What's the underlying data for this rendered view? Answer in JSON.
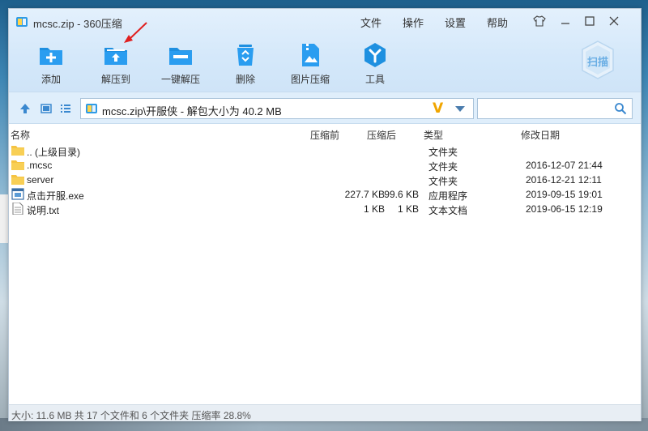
{
  "window": {
    "title": "mcsc.zip - 360压缩",
    "menu": [
      "文件",
      "操作",
      "设置",
      "帮助"
    ]
  },
  "toolbar": [
    {
      "label": "添加",
      "icon": "add-folder-icon"
    },
    {
      "label": "解压到",
      "icon": "extract-to-icon"
    },
    {
      "label": "一键解压",
      "icon": "one-click-extract-icon"
    },
    {
      "label": "删除",
      "icon": "recycle-bin-icon"
    },
    {
      "label": "图片压缩",
      "icon": "image-compress-icon"
    },
    {
      "label": "工具",
      "icon": "tools-icon"
    }
  ],
  "scan_label": "扫描",
  "address": {
    "path": "mcsc.zip\\开服侠 - 解包大小为 40.2 MB",
    "badge": "V",
    "search_placeholder": ""
  },
  "columns": {
    "name": "名称",
    "compressed_before": "压缩前",
    "compressed_after": "压缩后",
    "type": "类型",
    "modified": "修改日期"
  },
  "files": [
    {
      "name": ".. (上级目录)",
      "before": "",
      "after": "",
      "type": "文件夹",
      "date": "",
      "icon": "folder-icon"
    },
    {
      "name": ".mcsc",
      "before": "",
      "after": "",
      "type": "文件夹",
      "date": "2016-12-07 21:44",
      "icon": "folder-icon"
    },
    {
      "name": "server",
      "before": "",
      "after": "",
      "type": "文件夹",
      "date": "2016-12-21 12:11",
      "icon": "folder-icon"
    },
    {
      "name": "点击开服.exe",
      "before": "227.7 KB",
      "after": "99.6 KB",
      "type": "应用程序",
      "date": "2019-09-15 19:01",
      "icon": "exe-icon"
    },
    {
      "name": "说明.txt",
      "before": "1 KB",
      "after": "1 KB",
      "type": "文本文档",
      "date": "2019-06-15 12:19",
      "icon": "txt-icon"
    }
  ],
  "status": "大小: 11.6 MB 共 17 个文件和 6 个文件夹 压缩率 28.8%",
  "colors": {
    "accent": "#1e90e0",
    "folder": "#f5c342",
    "toolbar_bg": "#d4e8fa"
  }
}
